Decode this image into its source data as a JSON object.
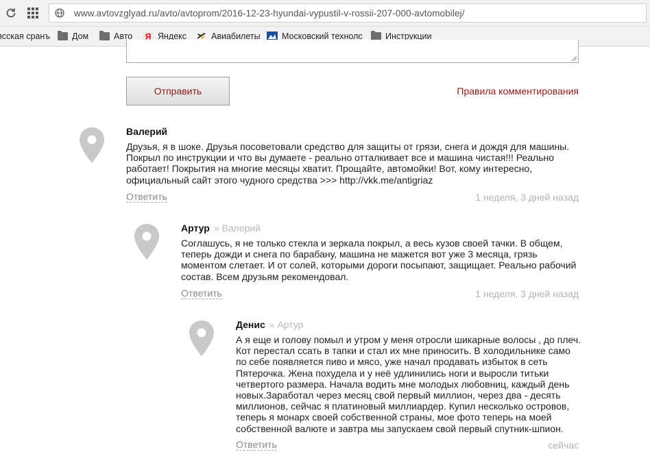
{
  "browser": {
    "url": "www.avtovzglyad.ru/avto/avtoprom/2016-12-23-hyundai-vypustil-v-rossii-207-000-avtomobilej/",
    "bookmarks": [
      {
        "label": "ясская сранъ",
        "icon": "folder-icon"
      },
      {
        "label": "Дом",
        "icon": "folder-icon"
      },
      {
        "label": "Авто",
        "icon": "folder-icon"
      },
      {
        "label": "Яндекс",
        "icon": "yandex-icon"
      },
      {
        "label": "Авиабилеты",
        "icon": "plane-icon"
      },
      {
        "label": "Московский технолс",
        "icon": "site-icon"
      },
      {
        "label": "Инструкции",
        "icon": "folder-icon"
      }
    ]
  },
  "form": {
    "submit_label": "Отправить",
    "rules_label": "Правила комментирования"
  },
  "comments": [
    {
      "author": "Валерий",
      "reply_to": "",
      "text": "Друзья, я в шоке. Друзья посоветовали средство для защиты от грязи, снега и дождя для машины. Покрыл по инструкции и что вы думаете - реально отталкивает все и машина чистая!!! Реально работает! Покрытия на многие месяцы хватит. Прощайте, автомойки! Вот, кому интересно, официальный сайт этого чудного средства >>> http://vkk.me/antigriaz",
      "reply_label": "Ответить",
      "time": "1 неделя, 3 дней назад"
    },
    {
      "author": "Артур",
      "reply_to": "» Валерий",
      "text": "Соглашусь, я не только стекла и зеркала покрыл, а весь кузов своей тачки. В общем, теперь дожди и снега по барабану, машина не мажется вот уже 3 месяца, грязь моментом слетает. И от солей, которыми дороги посыпают, защищает. Реально рабочий состав. Всем друзьям рекомендовал.",
      "reply_label": "Ответить",
      "time": "1 неделя, 3 дней назад"
    },
    {
      "author": "Денис",
      "reply_to": "» Артур",
      "text": "А я еще и голову помыл и утром у меня отросли шикарные волосы , до плеч. Кот перестал ссать в тапки и стал их мне приносить. В холодильнике само по себе появляется пиво и мясо, уже начал продавать избыток в сеть Пятерочка. Жена похудела и у неё удлинились ноги и выросли титьки четвертого размера. Начала водить мне молодых любовниц, каждый день новых.Заработал через месяц свой первый миллион, через два - десять миллионов, сейчас я платиновый миллиардер. Купил несколько островов, теперь я монарх своей собственной страны, мое фото теперь на моей собственной валюте и завтра мы запускаем свой первый спутник-шпион.",
      "reply_label": "Ответить",
      "time": "сейчас"
    }
  ]
}
